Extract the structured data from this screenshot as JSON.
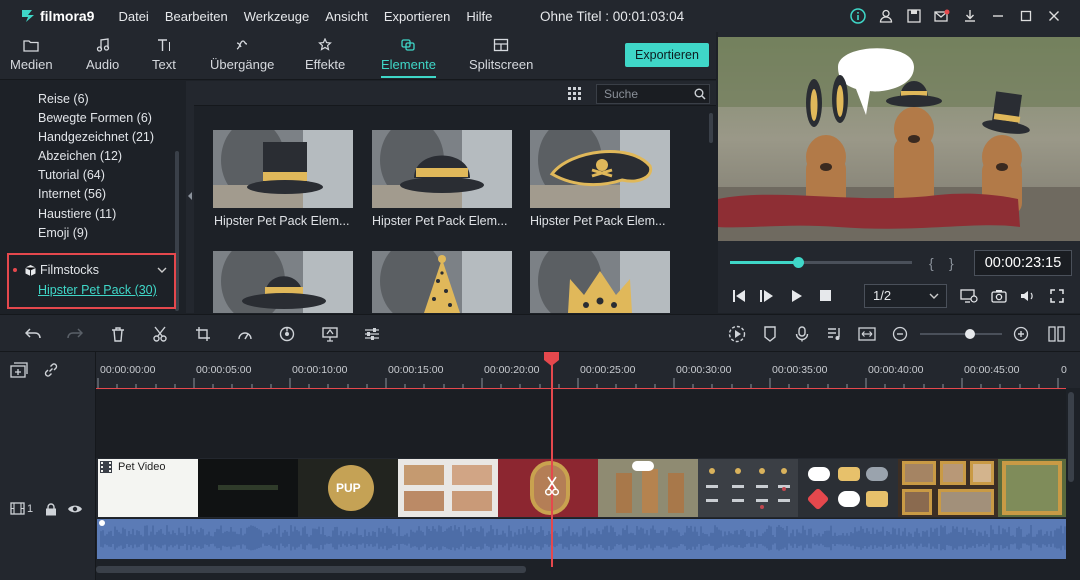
{
  "app": {
    "name": "filmora9",
    "title": "Ohne Titel : 00:01:03:04"
  },
  "menu": [
    "Datei",
    "Bearbeiten",
    "Werkzeuge",
    "Ansicht",
    "Exportieren",
    "Hilfe"
  ],
  "window_icons": [
    "info-icon",
    "account-icon",
    "save-icon",
    "mail-icon",
    "download-icon",
    "minimize-icon",
    "maximize-icon",
    "close-icon"
  ],
  "tabs": [
    {
      "label": "Medien",
      "icon": "folder-icon"
    },
    {
      "label": "Audio",
      "icon": "music-note-icon"
    },
    {
      "label": "Text",
      "icon": "text-icon"
    },
    {
      "label": "Übergänge",
      "icon": "transition-icon"
    },
    {
      "label": "Effekte",
      "icon": "effects-icon"
    },
    {
      "label": "Elemente",
      "icon": "elements-icon",
      "active": true
    },
    {
      "label": "Splitscreen",
      "icon": "splitscreen-icon"
    }
  ],
  "export_label": "Exportieren",
  "sidebar": {
    "categories": [
      "Reise (6)",
      "Bewegte Formen (6)",
      "Handgezeichnet (21)",
      "Abzeichen (12)",
      "Tutorial (64)",
      "Internet (56)",
      "Haustiere (11)",
      "Emoji (9)"
    ],
    "filmstocks_label": "Filmstocks",
    "filmstocks_item": "Hipster Pet Pack (30)"
  },
  "search": {
    "placeholder": "Suche"
  },
  "elements": [
    {
      "label": "Hipster Pet Pack Elem...",
      "icon": "top-hat"
    },
    {
      "label": "Hipster Pet Pack Elem...",
      "icon": "bowler-hat"
    },
    {
      "label": "Hipster Pet Pack Elem...",
      "icon": "pirate-hat"
    },
    {
      "label": "",
      "icon": "fedora-hat"
    },
    {
      "label": "",
      "icon": "party-hat"
    },
    {
      "label": "",
      "icon": "crown"
    }
  ],
  "preview": {
    "timecode": "00:00:23:15",
    "ratio": "1/2",
    "progress": 0.37
  },
  "timeline": {
    "ticks": [
      "00:00:00:00",
      "00:00:05:00",
      "00:00:10:00",
      "00:00:15:00",
      "00:00:20:00",
      "00:00:25:00",
      "00:00:30:00",
      "00:00:35:00",
      "00:00:40:00",
      "00:00:45:00"
    ],
    "track_label": "1",
    "clip_title": "Pet Video",
    "zoom": 0.6
  },
  "colors": {
    "accent": "#3fd7c8",
    "playhead": "#e5484d",
    "audio": "#5b7bb6"
  }
}
